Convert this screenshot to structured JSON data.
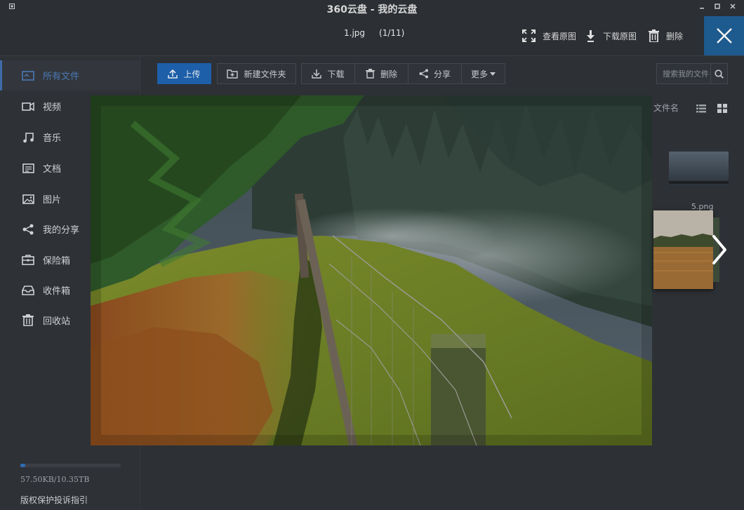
{
  "window": {
    "title": "360云盘 - 我的云盘"
  },
  "viewer": {
    "file_name": "1.jpg",
    "position": "(1/11)",
    "actions": {
      "view_original": "查看原图",
      "download_original": "下载原图",
      "delete": "删除"
    }
  },
  "sidebar": {
    "items": [
      {
        "label": "所有文件",
        "icon": "folder-icon",
        "active": true
      },
      {
        "label": "视频",
        "icon": "video-icon"
      },
      {
        "label": "音乐",
        "icon": "music-icon"
      },
      {
        "label": "文档",
        "icon": "document-icon"
      },
      {
        "label": "图片",
        "icon": "image-icon"
      },
      {
        "label": "我的分享",
        "icon": "share-icon"
      },
      {
        "label": "保险箱",
        "icon": "safe-icon"
      },
      {
        "label": "收件箱",
        "icon": "inbox-icon"
      },
      {
        "label": "回收站",
        "icon": "trash-icon"
      }
    ],
    "quota": {
      "text": "57.50KB/10.35TB",
      "used_fraction": 0.05
    },
    "copyright_link": "版权保护投诉指引"
  },
  "toolbar": {
    "upload": "上传",
    "new_folder": "新建文件夹",
    "download": "下载",
    "delete": "删除",
    "share": "分享",
    "more": "更多"
  },
  "search": {
    "placeholder": "搜索我的文件"
  },
  "list": {
    "sort_label": "文件名",
    "visible_file_name": "5.png"
  },
  "colors": {
    "accent": "#1d5fa8",
    "close_button": "#1d5a8e"
  }
}
